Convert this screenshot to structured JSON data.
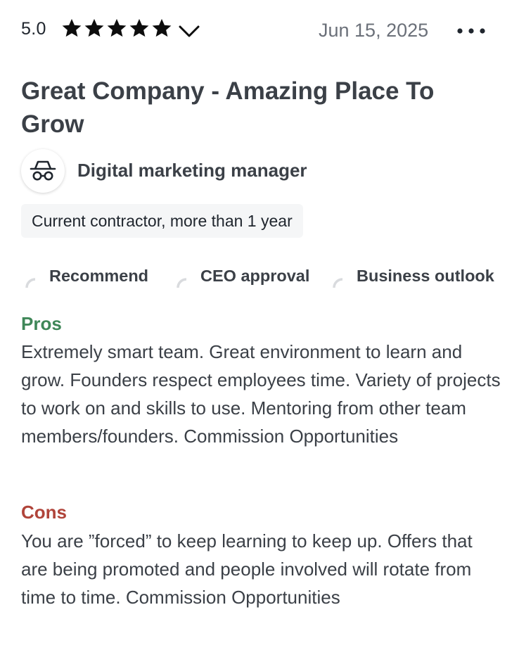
{
  "review": {
    "rating": "5.0",
    "stars": 5,
    "date": "Jun 15, 2025",
    "title": "Great Company - Amazing Place To Grow",
    "role": "Digital marketing manager",
    "employment_status": "Current contractor, more than 1 year",
    "ratings": [
      {
        "label": "Recommend",
        "icon": "partial-circle-icon"
      },
      {
        "label": "CEO approval",
        "icon": "partial-circle-icon"
      },
      {
        "label": "Business outlook",
        "icon": "partial-circle-icon"
      }
    ],
    "pros_label": "Pros",
    "pros_text": "Extremely smart team. Great environment to learn and grow. Founders respect employees time. Variety of projects to work on and skills to use. Mentoring from other team members/founders. Commission Opportunities",
    "cons_label": "Cons",
    "cons_text": "You are ”forced” to keep learning to keep up. Offers that are being promoted and people involved will rotate from time to time. Commission Opportunities"
  },
  "icons": {
    "star": "star-icon",
    "chevron": "chevron-down-icon",
    "more": "more-horizontal-icon",
    "avatar": "incognito-icon"
  },
  "colors": {
    "pros": "#3f8758",
    "cons": "#b0443a",
    "star": "#0d0d0d",
    "date": "#6b7079",
    "chip_background": "#f5f6f7"
  }
}
